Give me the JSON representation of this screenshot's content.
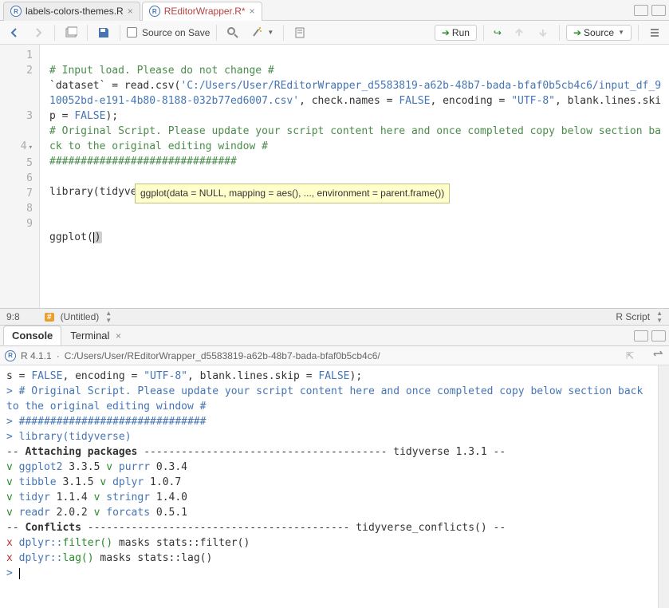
{
  "tabs": {
    "file1": "labels-colors-themes.R",
    "file2": "REditorWrapper.R*"
  },
  "toolbar": {
    "source_on_save": "Source on Save",
    "run": "Run",
    "source": "Source"
  },
  "gutter": [
    "1",
    "2",
    "3",
    "4",
    "5",
    "6",
    "7",
    "8",
    "9"
  ],
  "code": {
    "l1": "# Input load. Please do not change #",
    "l2a": "`dataset` = read.csv(",
    "l2b": "'C:/Users/User/REditorWrapper_d5583819-a62b-48b7-bada-bfaf0b5cb4c6/input_df_910052bd-e191-4b80-8188-032b77ed6007.csv'",
    "l2c": ", check.names = ",
    "l2d": "FALSE",
    "l2e": ", encoding = ",
    "l2f": "\"UTF-8\"",
    "l2g": ", blank.lines.skip = ",
    "l2h": "FALSE",
    "l2i": ");",
    "l3": "# Original Script. Please update your script content here and once completed copy below section back to the original editing window #",
    "l4": "##############################",
    "l6": "library(tidyverse)",
    "l9a": "ggplot(",
    "l9b": ")"
  },
  "tooltip": "ggplot(data = NULL, mapping = aes(), ..., environment = parent.frame())",
  "status": {
    "pos": "9:8",
    "title": "(Untitled)",
    "lang": "R Script"
  },
  "console_tabs": {
    "console": "Console",
    "terminal": "Terminal"
  },
  "console_hdr": {
    "version": "R 4.1.1",
    "sep": "·",
    "path": "C:/Users/User/REditorWrapper_d5583819-a62b-48b7-bada-bfaf0b5cb4c6/"
  },
  "console": {
    "l1a": "s = ",
    "l1b": "FALSE",
    "l1c": ", encoding = ",
    "l1d": "\"UTF-8\"",
    "l1e": ", blank.lines.skip = ",
    "l1f": "FALSE",
    "l1g": ");",
    "l2": "# Original Script. Please update your script content here and once completed copy below section back to the original editing window #",
    "l3": "##############################",
    "l4": "library(tidyverse)",
    "attach_label": "-- ",
    "attach_bold": "Attaching packages",
    "attach_dashes": " --------------------------------------- tidyverse 1.3.1 --",
    "pkg1a": "ggplot2",
    "pkg1b": "3.3.5",
    "pkg1c": "purrr",
    "pkg1d": "0.3.4",
    "pkg2a": "tibble",
    "pkg2b": "3.1.5",
    "pkg2c": "dplyr",
    "pkg2d": "1.0.7",
    "pkg3a": "tidyr",
    "pkg3b": "1.1.4",
    "pkg3c": "stringr",
    "pkg3d": "1.4.0",
    "pkg4a": "readr",
    "pkg4b": "2.0.2",
    "pkg4c": "forcats",
    "pkg4d": "0.5.1",
    "conf_label": "-- ",
    "conf_bold": "Conflicts",
    "conf_dashes": " ------------------------------------------ tidyverse_conflicts() --",
    "c1a": "dplyr::",
    "c1b": "filter()",
    "c1c": " masks ",
    "c1d": "stats::filter()",
    "c2a": "dplyr::",
    "c2b": "lag()",
    "c2c": "    masks ",
    "c2d": "stats::lag()",
    "v": "v",
    "x": "x",
    "gt": "> "
  }
}
